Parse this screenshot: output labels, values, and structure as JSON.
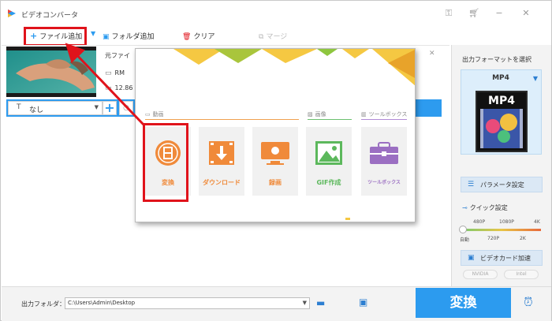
{
  "window": {
    "title": "ビデオコンバータ",
    "accent": "#2c9bef",
    "highlight": "#e0131b"
  },
  "titlebar_icons": [
    "key-icon",
    "cart-icon",
    "minimize-icon",
    "close-icon"
  ],
  "toolbar": {
    "add_file": "ファイル追加",
    "add_folder": "フォルダ追加",
    "clear": "クリア",
    "merge": "マージ"
  },
  "file": {
    "name_prefix": "元ファイ",
    "format": "RM",
    "size": "12.86",
    "subtitle_select": "なし",
    "add_button": "+"
  },
  "popup": {
    "categories": {
      "video": "動画",
      "image": "画像",
      "toolbox": "ツールボックス"
    },
    "tiles": [
      {
        "label": "変換",
        "icon": "film-icon",
        "color": "#f08a3a"
      },
      {
        "label": "ダウンロード",
        "icon": "download-icon",
        "color": "#f08a3a"
      },
      {
        "label": "録画",
        "icon": "screen-record-icon",
        "color": "#f08a3a"
      },
      {
        "label": "GIF作成",
        "icon": "image-icon",
        "color": "#5cb85c"
      },
      {
        "label": "ツールボックス",
        "icon": "toolbox-icon",
        "color": "#9b6fc2"
      }
    ]
  },
  "right_panel": {
    "title": "出力フォーマットを選択",
    "format": "MP4",
    "format_image_text": "MP4",
    "param_button": "パラメータ設定",
    "quick_title": "クイック設定",
    "res_top": [
      "480P",
      "1080P",
      "4K"
    ],
    "res_bottom": [
      "自動",
      "720P",
      "2K"
    ],
    "gpu_button": "ビデオカード加速",
    "chips": [
      "NVIDIA",
      "Intel"
    ]
  },
  "bottom": {
    "output_label": "出力フォルダ：",
    "output_path": "C:\\Users\\Admin\\Desktop",
    "convert": "変換"
  }
}
